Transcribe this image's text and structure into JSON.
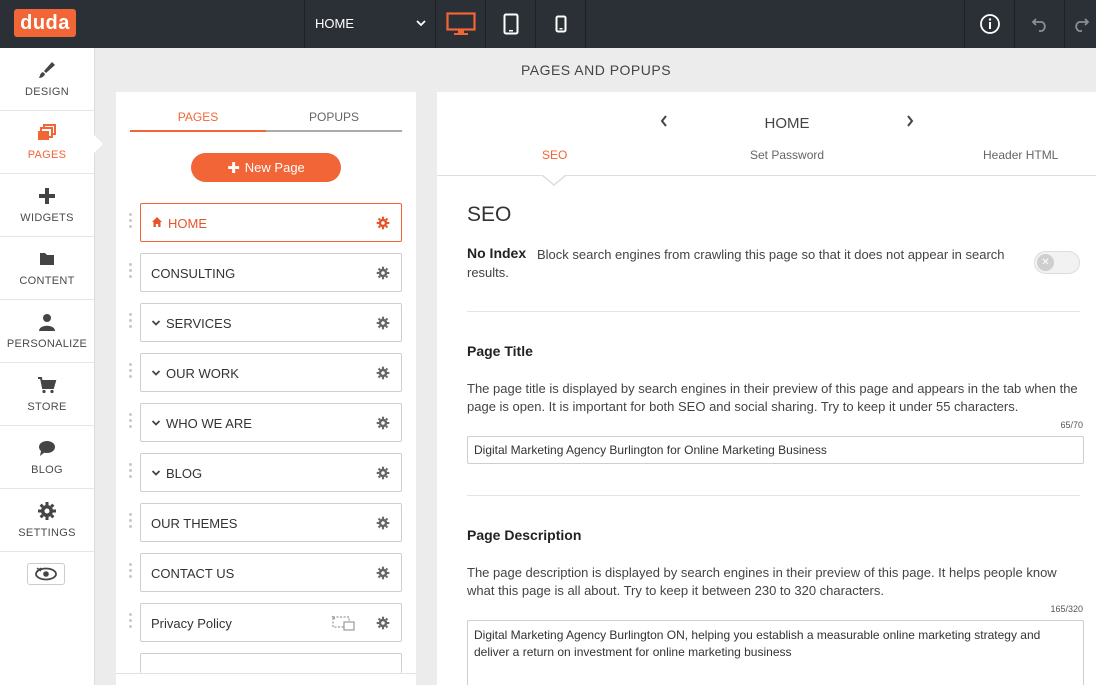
{
  "brand": {
    "logo": "duda",
    "accent": "#f26536"
  },
  "topbar": {
    "page_select": "HOME",
    "devices": [
      "desktop-icon",
      "tablet-icon",
      "mobile-icon"
    ],
    "active_device": "desktop"
  },
  "nav": {
    "items": [
      {
        "label": "DESIGN",
        "icon": "brush-icon"
      },
      {
        "label": "PAGES",
        "icon": "pages-icon",
        "active": true
      },
      {
        "label": "WIDGETS",
        "icon": "plus-icon"
      },
      {
        "label": "CONTENT",
        "icon": "folder-icon"
      },
      {
        "label": "PERSONALIZE",
        "icon": "person-icon"
      },
      {
        "label": "STORE",
        "icon": "cart-icon"
      },
      {
        "label": "BLOG",
        "icon": "chat-icon"
      },
      {
        "label": "SETTINGS",
        "icon": "gear-icon"
      }
    ]
  },
  "main": {
    "title": "PAGES AND POPUPS"
  },
  "pages_panel": {
    "tabs": [
      "PAGES",
      "POPUPS"
    ],
    "new_page": "New Page",
    "pages": [
      {
        "name": "HOME",
        "home": true,
        "active": true
      },
      {
        "name": "CONSULTING"
      },
      {
        "name": "SERVICES",
        "expandable": true
      },
      {
        "name": "OUR WORK",
        "expandable": true
      },
      {
        "name": "WHO WE ARE",
        "expandable": true
      },
      {
        "name": "BLOG",
        "expandable": true
      },
      {
        "name": "OUR THEMES"
      },
      {
        "name": "CONTACT US"
      },
      {
        "name": "Privacy Policy",
        "hidden_from_nav": true
      }
    ]
  },
  "settings": {
    "page_name": "HOME",
    "tabs": [
      "SEO",
      "Set Password",
      "Header HTML"
    ],
    "active_tab": "SEO",
    "seo_heading": "SEO",
    "no_index": {
      "title": "No Index",
      "desc": "Block search engines from crawling this page so that it does not appear in search results.",
      "enabled": false
    },
    "page_title": {
      "title": "Page Title",
      "desc": "The page title is displayed by search engines in their preview of this page and appears in the tab when the page is open. It is important for both SEO and social sharing. Try to keep it under 55 characters.",
      "counter": "65/70",
      "value": "Digital Marketing Agency Burlington for Online Marketing Business"
    },
    "page_description": {
      "title": "Page Description",
      "desc": "The page description is displayed by search engines in their preview of this page. It helps people know what this page is all about. Try to keep it between 230 to 320 characters.",
      "counter": "165/320",
      "value": "Digital Marketing Agency Burlington ON, helping you establish a measurable online marketing strategy and deliver a return on investment for online marketing business"
    }
  }
}
